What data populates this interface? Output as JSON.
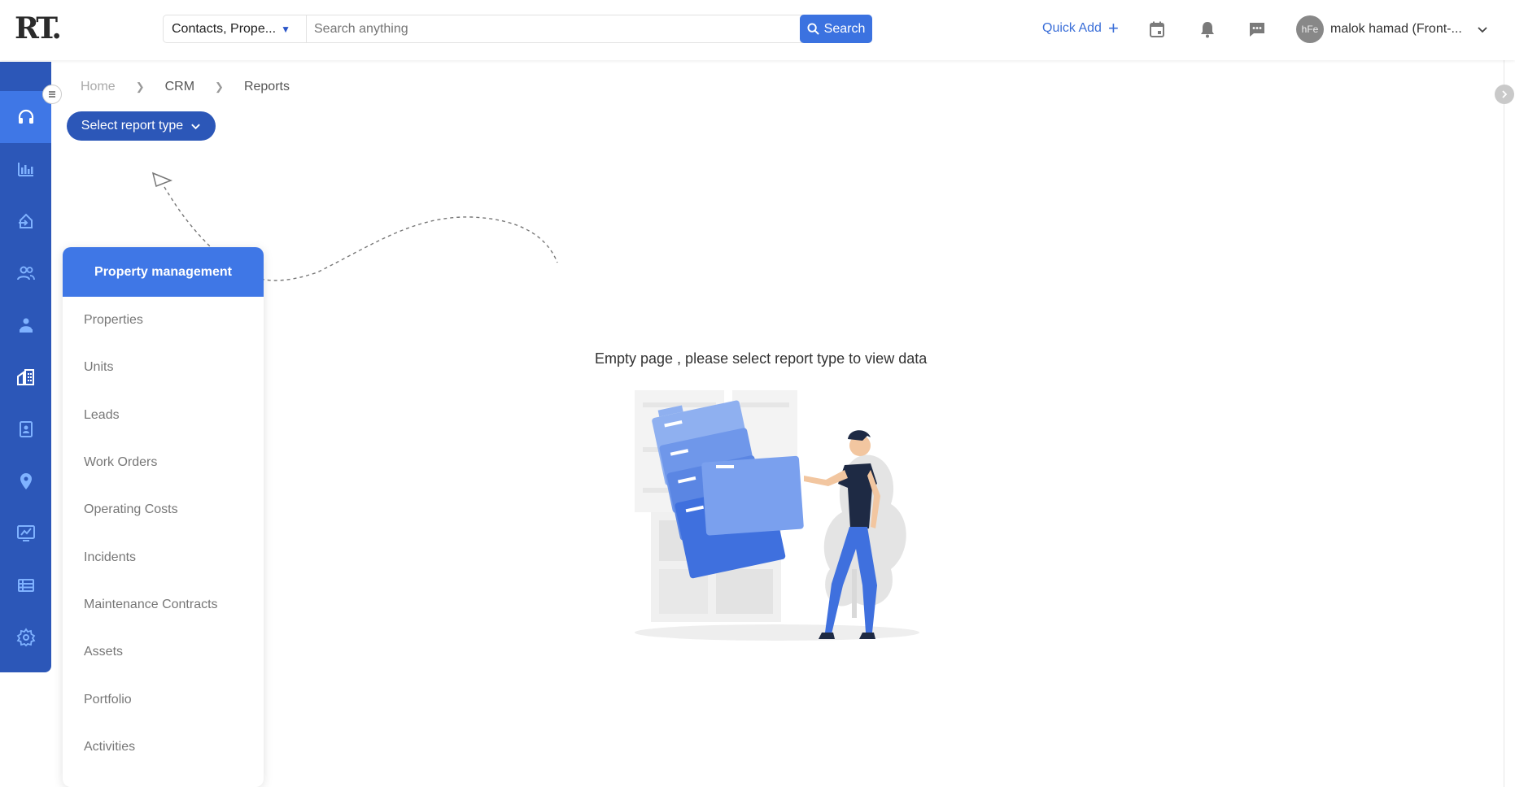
{
  "header": {
    "logo_text": "RT.",
    "search_scope": "Contacts, Prope...",
    "search_placeholder": "Search anything",
    "search_button": "Search",
    "quick_add": "Quick Add",
    "user": {
      "avatar_text": "hFe",
      "name": "malok hamad (Front-..."
    }
  },
  "sidebar": {
    "items": [
      {
        "icon": "headset-icon",
        "active": true
      },
      {
        "icon": "bar-chart-icon"
      },
      {
        "icon": "home-transfer-icon"
      },
      {
        "icon": "users-icon"
      },
      {
        "icon": "user-tree-icon"
      },
      {
        "icon": "buildings-icon"
      },
      {
        "icon": "contact-card-icon"
      },
      {
        "icon": "location-pin-icon"
      },
      {
        "icon": "monitor-chart-icon"
      },
      {
        "icon": "list-icon"
      },
      {
        "icon": "gear-icon"
      }
    ]
  },
  "breadcrumb": [
    "Home",
    "CRM",
    "Reports"
  ],
  "select_report_type": "Select report type",
  "report_menu": {
    "header": "Property management",
    "items": [
      "Properties",
      "Units",
      "Leads",
      "Work Orders",
      "Operating Costs",
      "Incidents",
      "Maintenance Contracts",
      "Assets",
      "Portfolio",
      "Activities"
    ]
  },
  "empty_state": {
    "message": "Empty page , please select report type to view data"
  },
  "colors": {
    "primary": "#2c57b8",
    "accent": "#3f77e6",
    "search_button": "#3b72e0"
  }
}
